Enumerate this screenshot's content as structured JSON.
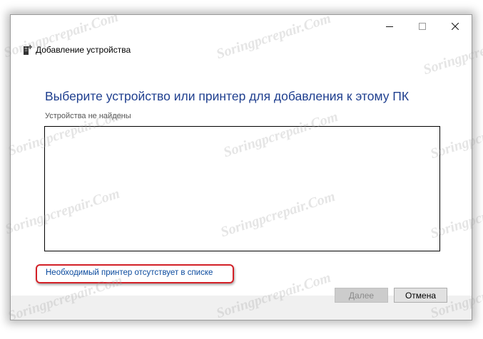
{
  "window": {
    "title": "Добавление устройства",
    "controls": {
      "minimize": "minimize-icon",
      "maximize": "maximize-icon",
      "close": "close-icon"
    }
  },
  "main": {
    "heading": "Выберите устройство или принтер для добавления к этому ПК",
    "status": "Устройства не найдены",
    "device_list": [],
    "missing_printer_link": "Необходимый принтер отсутствует в списке"
  },
  "footer": {
    "next_label": "Далее",
    "next_enabled": false,
    "cancel_label": "Отмена"
  },
  "watermark": {
    "text": "Soringpcrepair.Com"
  },
  "colors": {
    "heading": "#1f3f8f",
    "link": "#0a4a9e",
    "highlight": "#d32027",
    "footer_bg": "#f0f0f0"
  }
}
